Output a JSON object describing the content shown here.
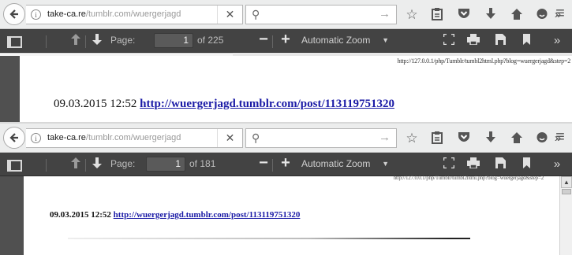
{
  "windows": [
    {
      "url": {
        "domain": "take-ca.re",
        "path": "/tumblr.com/wuergerjagd"
      },
      "search": {
        "placeholder": ""
      },
      "pdf_toolbar": {
        "page_label": "Page:",
        "current_page": "1",
        "page_count_text": "of 225",
        "zoom": "Automatic Zoom"
      },
      "document": {
        "header_url": "http://127.0.0.1/php/Tumblr/tumbl2html.php?blog=wuergerjagd&step=2",
        "timestamp": "09.03.2015 12:52",
        "link": "http://wuergerjagd.tumblr.com/post/113119751320"
      }
    },
    {
      "url": {
        "domain": "take-ca.re",
        "path": "/tumblr.com/wuergerjagd"
      },
      "search": {
        "placeholder": ""
      },
      "pdf_toolbar": {
        "page_label": "Page:",
        "current_page": "1",
        "page_count_text": "of 181",
        "zoom": "Automatic Zoom"
      },
      "document": {
        "header_url": "http://127.0.0.1/php/Tumblr/tumbl2html.php?blog=wuergerjagd&step=2",
        "timestamp": "09.03.2015 12:52",
        "link": "http://wuergerjagd.tumblr.com/post/113119751320"
      }
    }
  ],
  "icons": {
    "back": "back-arrow-icon",
    "info": "info-icon",
    "clear": "close-icon",
    "search": "search-icon",
    "go": "arrow-right-icon",
    "bookmark_star": "star-icon",
    "reading_list": "clipboard-icon",
    "pocket": "pocket-icon",
    "downloads": "download-icon",
    "home": "home-icon",
    "chat": "chat-icon",
    "overflow": "double-chevron-right-icon",
    "menu": "hamburger-menu-icon",
    "sidebar": "sidebar-toggle-icon",
    "prev_page": "arrow-up-icon",
    "next_page": "arrow-down-icon",
    "zoom_out": "minus-icon",
    "zoom_in": "plus-icon",
    "presentation": "fullscreen-icon",
    "print": "printer-icon",
    "save": "save-icon",
    "bookmark": "bookmark-icon"
  }
}
